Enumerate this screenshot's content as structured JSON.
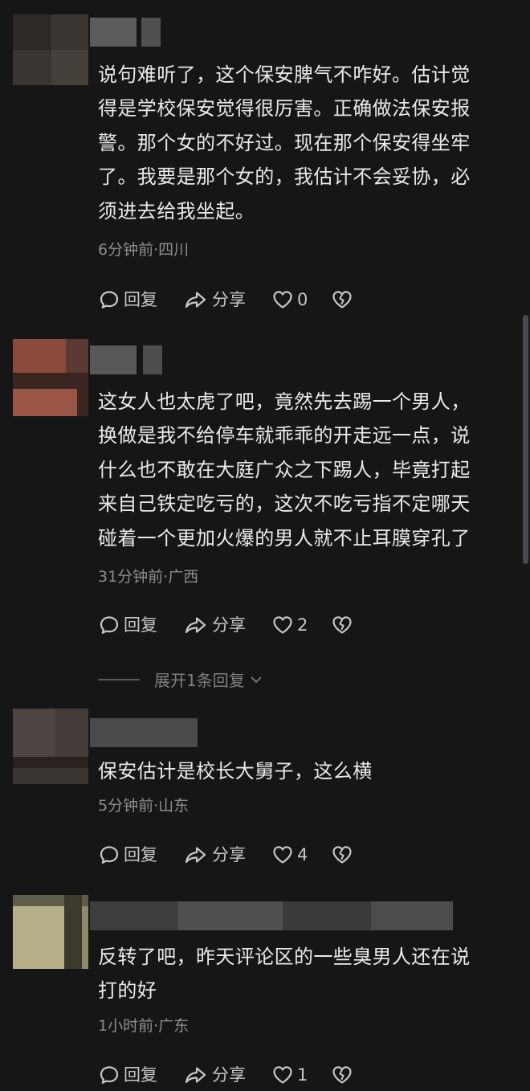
{
  "comments": [
    {
      "lines": [
        "说句难听了，这个保安脾气不咋好。估计觉",
        "得是学校保安觉得很厉害。正确做法保安报",
        "警。那个女的不好过。现在那个保安得坐牢",
        "了。我要是那个女的，我估计不会妥协，必",
        "须进去给我坐起。"
      ],
      "meta": "6分钟前·四川",
      "reply_label": "回复",
      "share_label": "分享",
      "like_count": "0"
    },
    {
      "lines": [
        "这女人也太虎了吧，竟然先去踢一个男人，",
        "换做是我不给停车就乖乖的开走远一点，说",
        "什么也不敢在大庭广众之下踢人，毕竟打起",
        "来自己铁定吃亏的，这次不吃亏指不定哪天",
        "碰着一个更加火爆的男人就不止耳膜穿孔了"
      ],
      "meta": "31分钟前·广西",
      "reply_label": "回复",
      "share_label": "分享",
      "like_count": "2",
      "expand_label": "展开1条回复"
    },
    {
      "lines": [
        "保安估计是校长大舅子，这么横"
      ],
      "meta": "5分钟前·山东",
      "reply_label": "回复",
      "share_label": "分享",
      "like_count": "4"
    },
    {
      "lines": [
        "反转了吧，昨天评论区的一些臭男人还在说",
        "打的好"
      ],
      "meta": "1小时前·广东",
      "reply_label": "回复",
      "share_label": "分享",
      "like_count": "1"
    }
  ],
  "colors": {
    "background": "#161617",
    "text": "#eaeaea",
    "meta": "#8e8e92",
    "action": "#c7c7cb"
  },
  "icons": [
    "comment-icon",
    "share-icon",
    "heart-icon",
    "broken-heart-icon",
    "chevron-down-icon"
  ]
}
